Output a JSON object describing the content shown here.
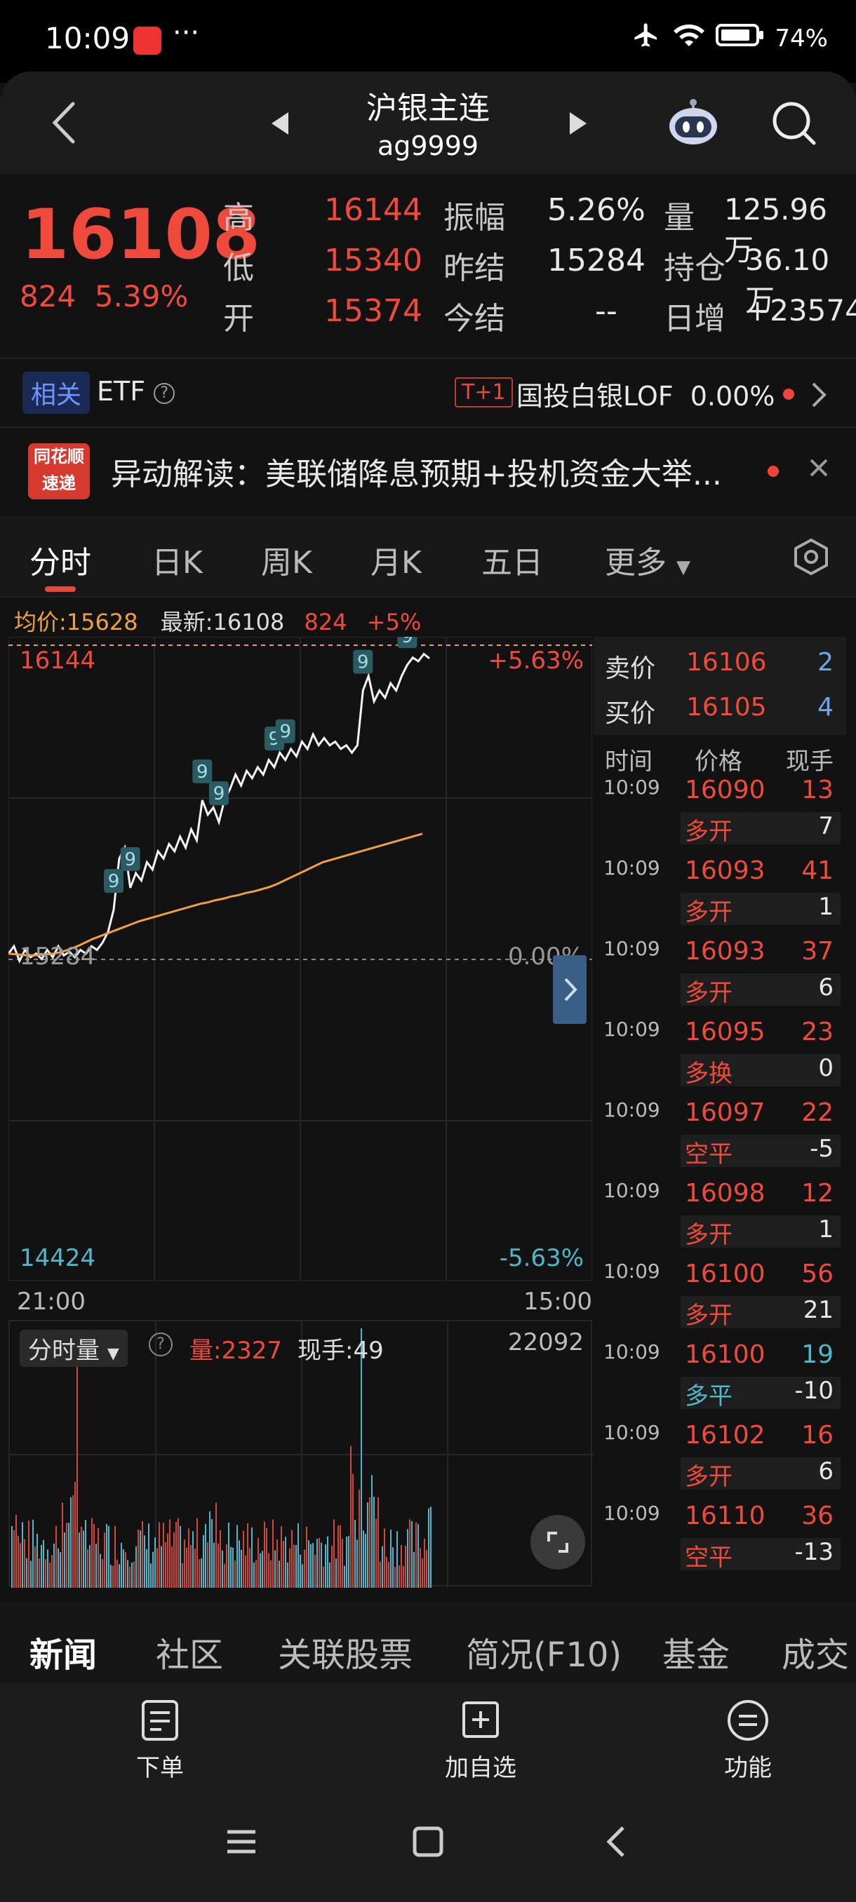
{
  "status": {
    "time": "10:09",
    "dots": "···",
    "battery": "74%"
  },
  "header": {
    "title": "沪银主连",
    "code": "ag9999"
  },
  "quote": {
    "price": "16108",
    "change": "824",
    "change_pct": "5.39%",
    "high_label": "高",
    "high": "16144",
    "low_label": "低",
    "low": "15340",
    "open_label": "开",
    "open": "15374",
    "amp_label": "振幅",
    "amp": "5.26%",
    "prev_label": "昨结",
    "prev": "15284",
    "settle_label": "今结",
    "settle": "--",
    "vol_label": "量",
    "vol": "125.96万",
    "oi_label": "持仓",
    "oi": "36.10万",
    "day_label": "日增",
    "day": "+23574"
  },
  "etf": {
    "tag": "相关",
    "label": "ETF",
    "t1": "T+1",
    "name": "国投白银LOF",
    "pct": "0.00%"
  },
  "flash": {
    "logo_top": "同花顺",
    "logo_bottom": "速递",
    "text": "异动解读：美联储降息预期+投机资金大举..."
  },
  "tabs": [
    "分时",
    "日K",
    "周K",
    "月K",
    "五日",
    "更多"
  ],
  "info": {
    "avg": "均价:15628",
    "latest": "最新:16108",
    "chg": "824",
    "pct": "+5%"
  },
  "chart": {
    "top_label": "16144",
    "top_pct": "+5.63%",
    "mid_label": "15284",
    "mid_pct": "0.00%",
    "bot_label": "14424",
    "bot_pct": "-5.63%",
    "t_start": "21:00",
    "t_end": "15:00",
    "vol_label": "分时量",
    "vol_value": "量:2327",
    "vol_hand": "现手:49",
    "vol_max": "22092",
    "marker": "9"
  },
  "chart_data": {
    "type": "line",
    "ylim": [
      14424,
      16144
    ],
    "series": [
      {
        "values": [
          15300,
          15320,
          15280,
          15310,
          15290,
          15300,
          15285,
          15310,
          15290,
          15320,
          15295,
          15305,
          15290,
          15310,
          15300,
          15320,
          15310,
          15330,
          15360,
          15420,
          15560,
          15590,
          15480,
          15520,
          15500,
          15550,
          15530,
          15580,
          15560,
          15600,
          15580,
          15620,
          15590,
          15640,
          15610,
          15720,
          15680,
          15700,
          15660,
          15720,
          15750,
          15790,
          15760,
          15800,
          15780,
          15810,
          15790,
          15830,
          15810,
          15850,
          15830,
          15860,
          15840,
          15880,
          15860,
          15900,
          15870,
          15890,
          15870,
          15880,
          15860,
          15870,
          15850,
          15870,
          16020,
          16060,
          15990,
          16020,
          16000,
          16040,
          16020,
          16060,
          16090,
          16110,
          16100,
          16120,
          16108
        ]
      },
      {
        "values": [
          15300,
          15298,
          15296,
          15295,
          15296,
          15298,
          15300,
          15305,
          15312,
          15320,
          15330,
          15340,
          15348,
          15356,
          15364,
          15372,
          15380,
          15388,
          15394,
          15400,
          15406,
          15412,
          15418,
          15424,
          15430,
          15436,
          15440,
          15446,
          15450,
          15456,
          15460,
          15466,
          15470,
          15476,
          15482,
          15490,
          15500,
          15510,
          15520,
          15530,
          15540,
          15550,
          15556,
          15562,
          15568,
          15574,
          15580,
          15586,
          15592,
          15598,
          15604,
          15610,
          15616,
          15622,
          15628
        ]
      }
    ]
  },
  "orderbook": {
    "sell_label": "卖价",
    "sell_price": "16106",
    "sell_qty": "2",
    "buy_label": "买价",
    "buy_price": "16105",
    "buy_qty": "4"
  },
  "trades_header": {
    "time": "时间",
    "price": "价格",
    "hand": "现手"
  },
  "trades": [
    {
      "time": "10:09",
      "price": "16090",
      "vol": "13",
      "type": "多开",
      "hand": "7",
      "tc": "red"
    },
    {
      "time": "10:09",
      "price": "16093",
      "vol": "41",
      "type": "多开",
      "hand": "1",
      "tc": "red"
    },
    {
      "time": "10:09",
      "price": "16093",
      "vol": "37",
      "type": "多开",
      "hand": "6",
      "tc": "red"
    },
    {
      "time": "10:09",
      "price": "16095",
      "vol": "23",
      "type": "多换",
      "hand": "0",
      "tc": "red"
    },
    {
      "time": "10:09",
      "price": "16097",
      "vol": "22",
      "type": "空平",
      "hand": "-5",
      "tc": "red"
    },
    {
      "time": "10:09",
      "price": "16098",
      "vol": "12",
      "type": "多开",
      "hand": "1",
      "tc": "red"
    },
    {
      "time": "10:09",
      "price": "16100",
      "vol": "56",
      "type": "多开",
      "hand": "21",
      "tc": "red"
    },
    {
      "time": "10:09",
      "price": "16100",
      "vol": "19",
      "type": "多平",
      "hand": "-10",
      "tc": "cyan"
    },
    {
      "time": "10:09",
      "price": "16102",
      "vol": "16",
      "type": "多开",
      "hand": "6",
      "tc": "red"
    },
    {
      "time": "10:09",
      "price": "16110",
      "vol": "36",
      "type": "空平",
      "hand": "-13",
      "tc": "red"
    }
  ],
  "bottom_tabs": [
    "新闻",
    "社区",
    "关联股票",
    "简况(F10)",
    "基金",
    "成交"
  ],
  "actions": {
    "order": "下单",
    "watch": "加自选",
    "func": "功能"
  },
  "colors": {
    "up": "#f04a3c",
    "down": "#4fb7c9",
    "avg": "#f0a040",
    "bg": "#121212"
  }
}
